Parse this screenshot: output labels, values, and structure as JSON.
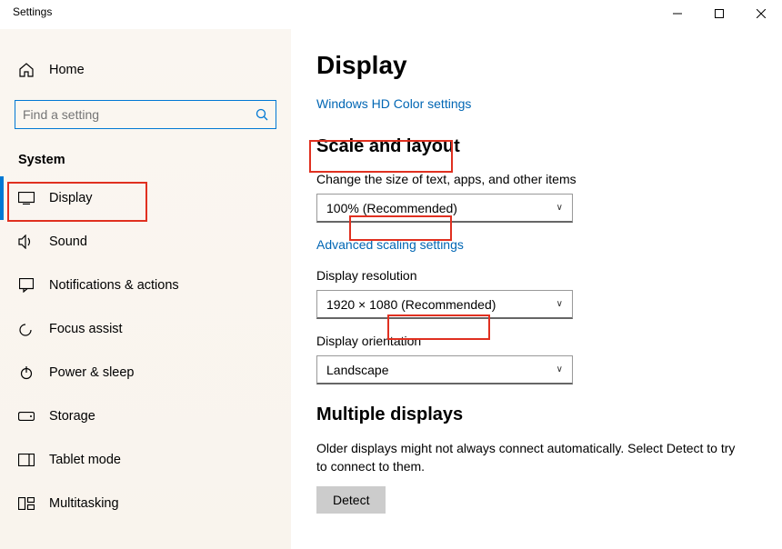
{
  "window": {
    "title": "Settings"
  },
  "sidebar": {
    "home": "Home",
    "search_placeholder": "Find a setting",
    "category": "System",
    "items": [
      {
        "label": "Display"
      },
      {
        "label": "Sound"
      },
      {
        "label": "Notifications & actions"
      },
      {
        "label": "Focus assist"
      },
      {
        "label": "Power & sleep"
      },
      {
        "label": "Storage"
      },
      {
        "label": "Tablet mode"
      },
      {
        "label": "Multitasking"
      }
    ]
  },
  "main": {
    "title": "Display",
    "hd_color_link": "Windows HD Color settings",
    "scale_section": "Scale and layout",
    "scale_label": "Change the size of text, apps, and other items",
    "scale_value": "100% (Recommended)",
    "advanced_scaling_link": "Advanced scaling settings",
    "resolution_label": "Display resolution",
    "resolution_value": "1920 × 1080 (Recommended)",
    "orientation_label": "Display orientation",
    "orientation_value": "Landscape",
    "multiple_section": "Multiple displays",
    "multiple_text": "Older displays might not always connect automatically. Select Detect to try to connect to them.",
    "detect_button": "Detect"
  }
}
